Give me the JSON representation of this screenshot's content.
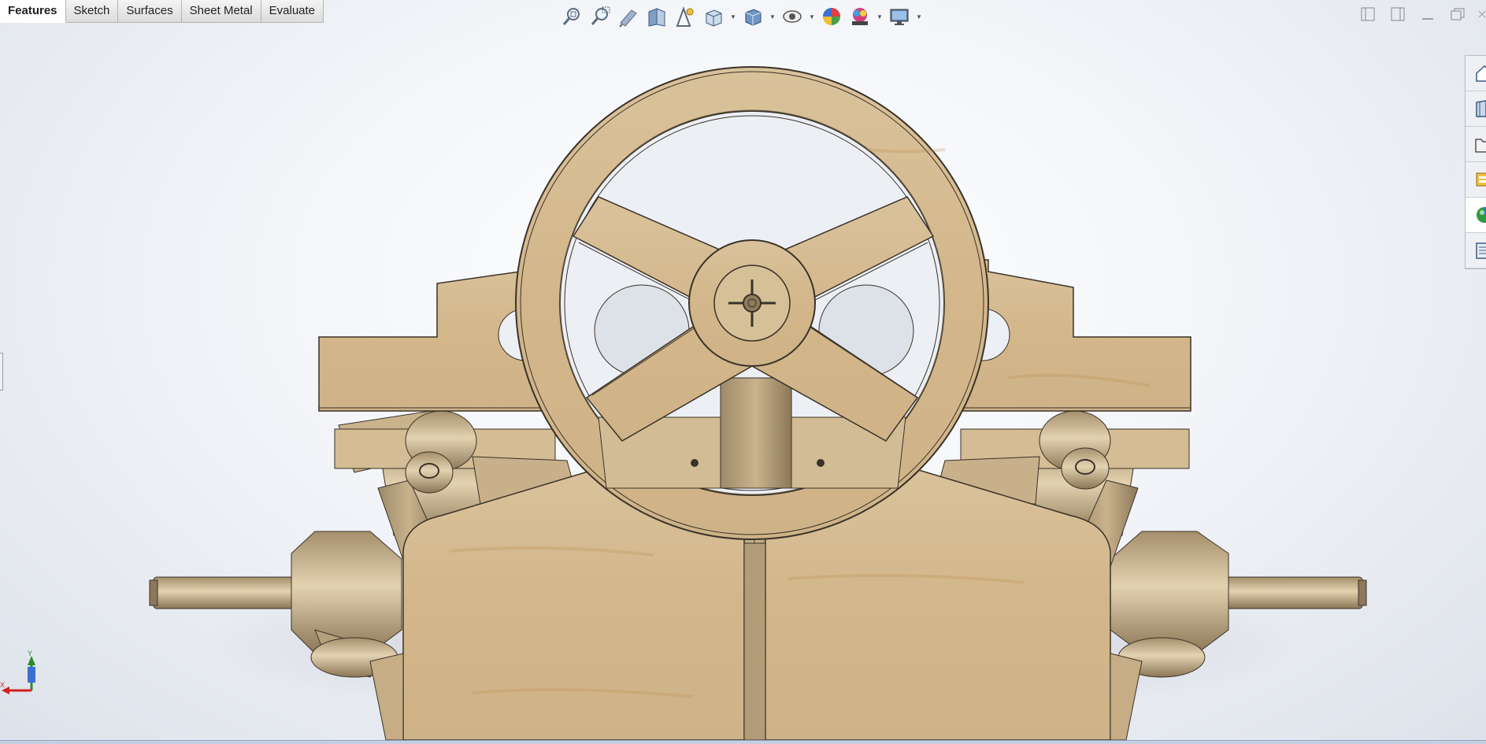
{
  "command_manager": {
    "tabs": [
      {
        "label": "Features",
        "active": true
      },
      {
        "label": "Sketch",
        "active": false
      },
      {
        "label": "Surfaces",
        "active": false
      },
      {
        "label": "Sheet Metal",
        "active": false
      },
      {
        "label": "Evaluate",
        "active": false
      }
    ]
  },
  "heads_up_toolbar": {
    "icons": [
      "zoom-to-fit-icon",
      "zoom-to-area-icon",
      "previous-view-icon",
      "section-view-icon",
      "dynamic-annotation-icon",
      "view-orientation-icon",
      "display-style-icon",
      "hide-show-items-icon",
      "edit-appearance-icon",
      "apply-scene-icon",
      "view-settings-icon"
    ]
  },
  "window_controls": [
    "tile-left-icon",
    "tile-right-icon",
    "minimize-icon",
    "restore-icon",
    "close-icon"
  ],
  "task_pane": {
    "icons": [
      "solidworks-resources-icon",
      "design-library-icon",
      "file-explorer-icon",
      "view-palette-icon",
      "appearances-scenes-icon",
      "custom-properties-icon"
    ],
    "selected_index": 4
  },
  "triad": {
    "y_label": "Y",
    "x_label": "X"
  },
  "colors": {
    "wood": "#d8bf96",
    "edge": "#3a3228",
    "background_center": "#ffffff",
    "background_edge": "#dde2ea"
  }
}
